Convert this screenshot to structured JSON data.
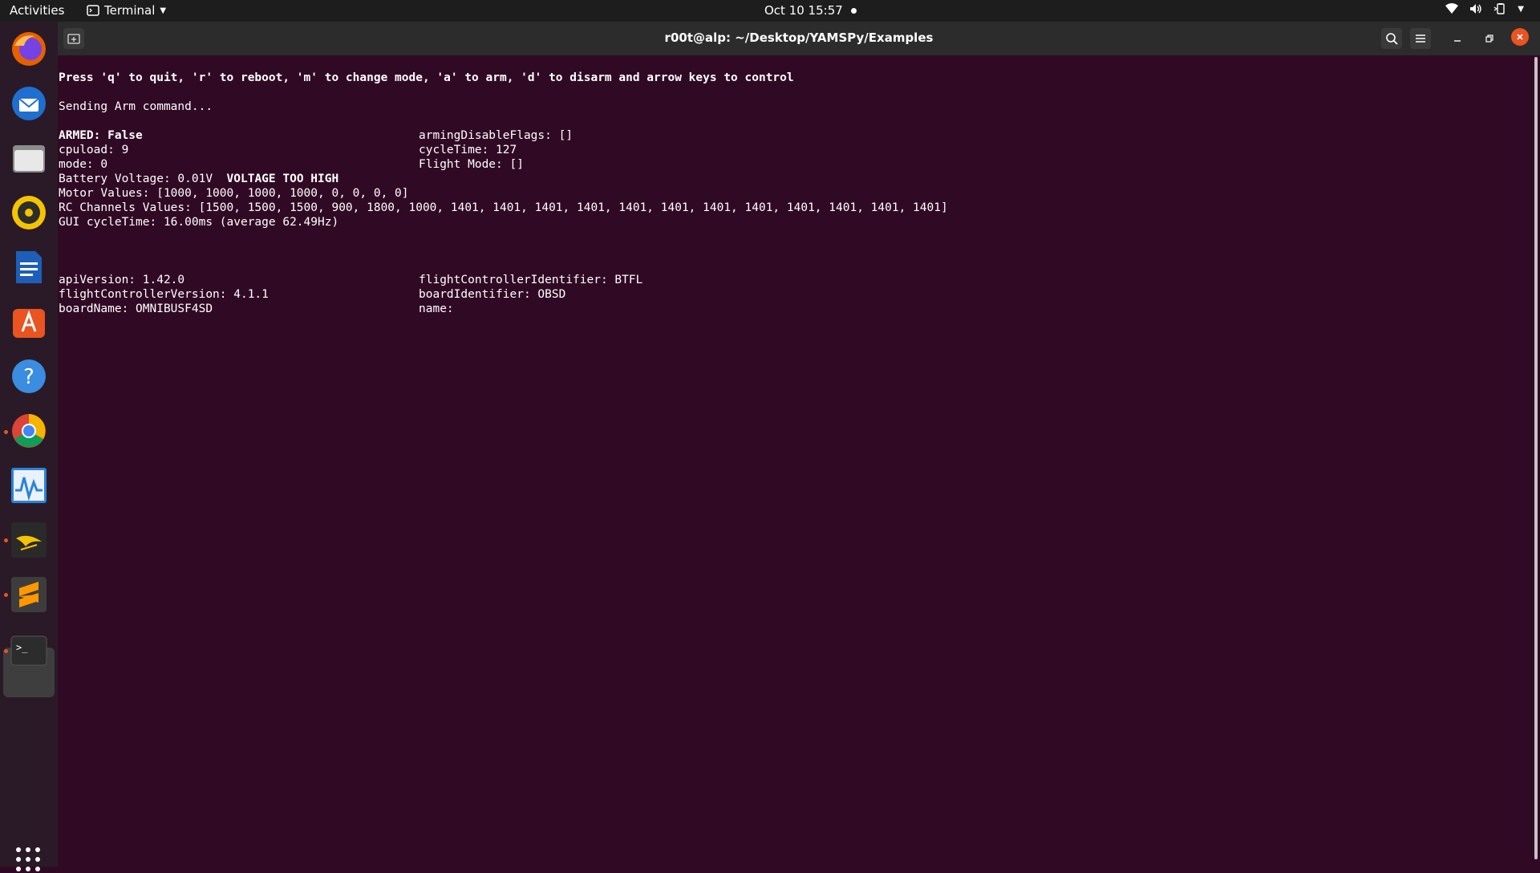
{
  "topbar": {
    "activities": "Activities",
    "app_name": "Terminal",
    "datetime": "Oct 10  15:57"
  },
  "dock": {
    "items": [
      "firefox-icon",
      "thunderbird-icon",
      "files-icon",
      "rhythmbox-icon",
      "writer-icon",
      "software-icon",
      "help-icon",
      "chrome-icon",
      "system-monitor-icon",
      "bird-app-icon",
      "sublime-text-icon",
      "terminal-icon",
      "show-apps-icon"
    ]
  },
  "window": {
    "title": "r00t@alp: ~/Desktop/YAMSPy/Examples"
  },
  "terminal": {
    "instructions": "Press 'q' to quit, 'r' to reboot, 'm' to change mode, 'a' to arm, 'd' to disarm and arrow keys to control",
    "sending": "Sending Arm command...",
    "armed": "ARMED: False",
    "cpuload": "cpuload: 9",
    "mode": "mode: 0",
    "battery": "Battery Voltage: 0.01V",
    "battery_warning": "VOLTAGE TOO HIGH",
    "motor": "Motor Values: [1000, 1000, 1000, 1000, 0, 0, 0, 0]",
    "rc": "RC Channels Values: [1500, 1500, 1500, 900, 1800, 1000, 1401, 1401, 1401, 1401, 1401, 1401, 1401, 1401, 1401, 1401, 1401, 1401]",
    "gui": "GUI cycleTime: 16.00ms (average 62.49Hz)",
    "arming_flags": "armingDisableFlags: []",
    "cycletime": "cycleTime: 127",
    "flight_mode": "Flight Mode: []",
    "api_version": "apiVersion: 1.42.0",
    "fc_version": "flightControllerVersion: 4.1.1",
    "board_name": "boardName: OMNIBUSF4SD",
    "fc_identifier": "flightControllerIdentifier: BTFL",
    "board_identifier": "boardIdentifier: OBSD",
    "name": "name:"
  }
}
